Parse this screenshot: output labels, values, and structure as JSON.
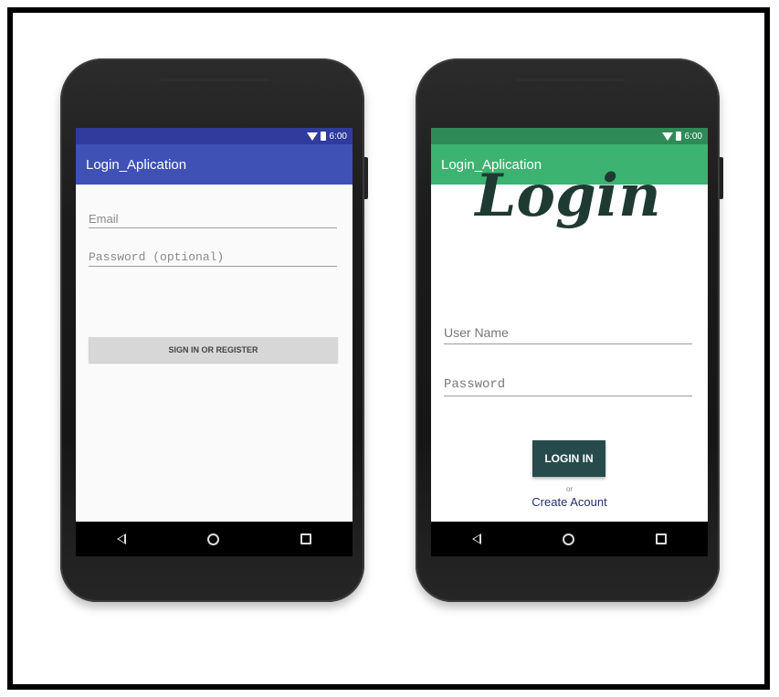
{
  "phones": [
    {
      "status_time": "6:00",
      "app_title": "Login_Aplication",
      "colors": {
        "status": "#2f3c9e",
        "appbar": "#3f51b5"
      },
      "email_placeholder": "Email",
      "password_placeholder": "Password (optional)",
      "button_label": "SIGN IN OR REGISTER"
    },
    {
      "status_time": "6:00",
      "app_title": "Login_Aplication",
      "colors": {
        "status": "#2e8b57",
        "appbar": "#3cb371",
        "button": "#274b4d",
        "logo": "#1f3a33"
      },
      "logo_text": "Login",
      "username_placeholder": "User Name",
      "password_placeholder": "Password",
      "button_label": "LOGIN IN",
      "or_text": "or",
      "link_text": "Create Acount"
    }
  ],
  "icons": [
    "wifi-icon",
    "battery-icon",
    "nav-back-icon",
    "nav-home-icon",
    "nav-recent-icon"
  ]
}
